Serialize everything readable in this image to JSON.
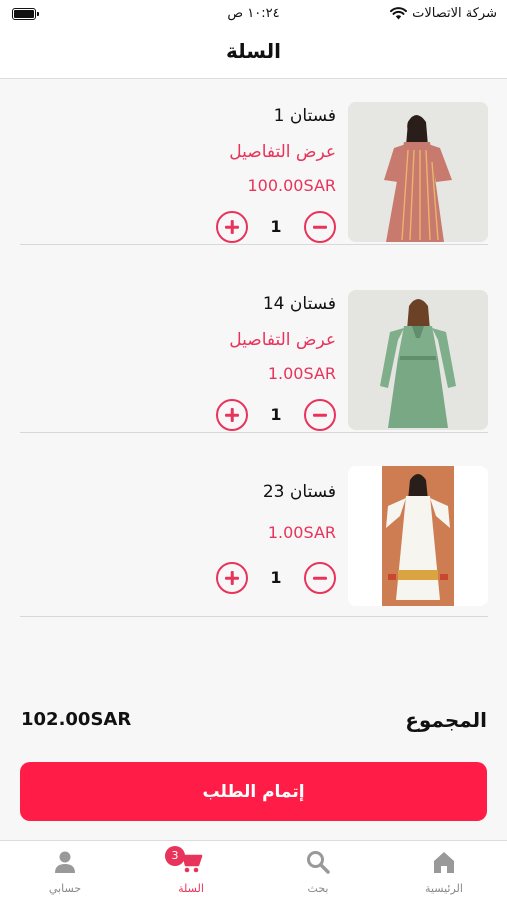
{
  "status_bar": {
    "carrier": "شركة الاتصالات",
    "time": "١٠:٢٤ ص",
    "battery_level": 1.0
  },
  "nav": {
    "title": "السلة"
  },
  "cart": {
    "items": [
      {
        "name": "فستان 1",
        "details_link": "عرض التفاصيل",
        "price": "100.00SAR",
        "quantity": "1"
      },
      {
        "name": "فستان 14",
        "details_link": "عرض التفاصيل",
        "price": "1.00SAR",
        "quantity": "1"
      },
      {
        "name": "فستان 23",
        "price": "1.00SAR",
        "quantity": "1"
      }
    ]
  },
  "summary": {
    "total_label": "المجموع",
    "total_value": "102.00SAR"
  },
  "checkout": {
    "label": "إتمام الطلب"
  },
  "tab_bar": {
    "tabs": [
      {
        "label": "الرئيسية",
        "icon": "home-icon"
      },
      {
        "label": "بحث",
        "icon": "search-icon"
      },
      {
        "label": "السلة",
        "icon": "cart-icon",
        "badge": "3",
        "active": true
      },
      {
        "label": "حسابي",
        "icon": "person-icon"
      }
    ]
  },
  "colors": {
    "accent": "#e8335a",
    "checkout_button": "#ff1d48",
    "inactive_tab": "#888888"
  }
}
